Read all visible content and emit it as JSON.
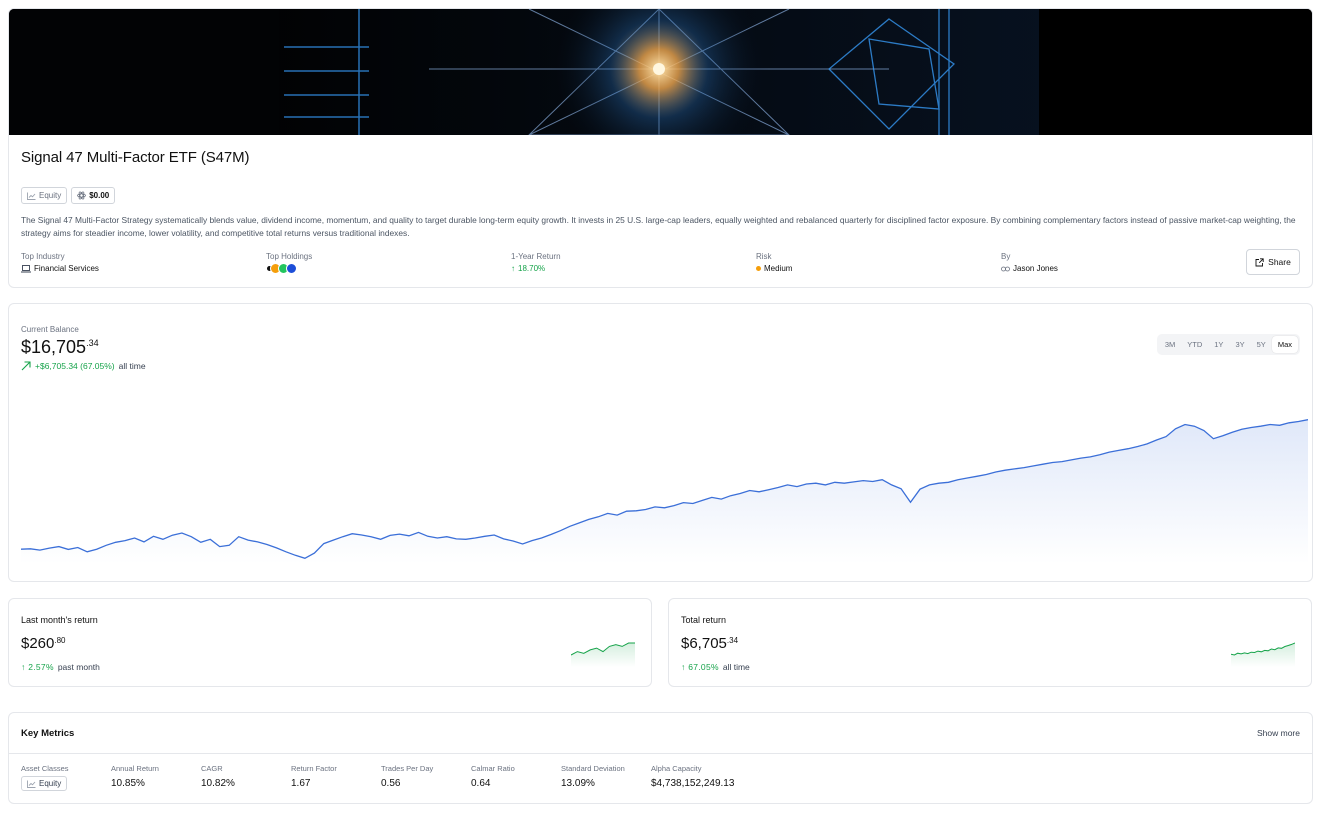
{
  "strategy": {
    "title": "Signal 47 Multi-Factor ETF (S47M)",
    "badges": {
      "asset_class": "Equity",
      "price": "$0.00"
    },
    "description": "The Signal 47 Multi-Factor Strategy systematically blends value, dividend income, momentum, and quality to target durable long-term equity growth. It invests in 25 U.S. large-cap leaders, equally weighted and rebalanced quarterly for disciplined factor exposure. By combining complementary factors instead of passive market-cap weighting, the strategy aims for steadier income, lower volatility, and competitive total returns versus traditional indexes.",
    "stats": {
      "top_industry_label": "Top Industry",
      "top_industry_value": "Financial Services",
      "top_holdings_label": "Top Holdings",
      "one_year_label": "1-Year Return",
      "one_year_value": "18.70%",
      "risk_label": "Risk",
      "risk_value": "Medium",
      "by_label": "By",
      "by_value": "Jason Jones"
    },
    "share_label": "Share",
    "holding_colors": [
      "#111111",
      "#f59e0b",
      "#22c55e",
      "#1d4ed8"
    ]
  },
  "balance": {
    "label": "Current Balance",
    "value_main": "$16,705",
    "value_cents": ".34",
    "change": "+$6,705.34 (67.05%)",
    "change_suffix": "all time",
    "ranges": [
      "3M",
      "YTD",
      "1Y",
      "3Y",
      "5Y",
      "Max"
    ],
    "active_range": "Max"
  },
  "last_month": {
    "label": "Last month's return",
    "value_main": "$260",
    "value_cents": ".80",
    "change": "2.57%",
    "change_suffix": "past month"
  },
  "total_return": {
    "label": "Total return",
    "value_main": "$6,705",
    "value_cents": ".34",
    "change": "67.05%",
    "change_suffix": "all time"
  },
  "metrics": {
    "title": "Key Metrics",
    "show_more": "Show more",
    "items": [
      {
        "label": "Asset Classes",
        "value": "Equity"
      },
      {
        "label": "Annual Return",
        "value": "10.85%"
      },
      {
        "label": "CAGR",
        "value": "10.82%"
      },
      {
        "label": "Return Factor",
        "value": "1.67"
      },
      {
        "label": "Trades Per Day",
        "value": "0.56"
      },
      {
        "label": "Calmar Ratio",
        "value": "0.64"
      },
      {
        "label": "Standard Deviation",
        "value": "13.09%"
      },
      {
        "label": "Alpha Capacity",
        "value": "$4,738,152,249.13"
      }
    ]
  },
  "colors": {
    "accent": "#3b6fd8",
    "positive": "#16a34a",
    "risk": "#f59e0b"
  },
  "chart_data": {
    "type": "area",
    "ylim": [
      9800,
      17400
    ],
    "values": [
      10300,
      10320,
      10260,
      10350,
      10420,
      10290,
      10380,
      10180,
      10300,
      10480,
      10620,
      10700,
      10820,
      10640,
      10900,
      10760,
      10950,
      11050,
      10880,
      10620,
      10760,
      10420,
      10480,
      10880,
      10720,
      10640,
      10520,
      10360,
      10180,
      10020,
      9880,
      10120,
      10560,
      10720,
      10880,
      11020,
      10960,
      10880,
      10760,
      10940,
      11000,
      10920,
      11080,
      10900,
      10820,
      10880,
      10780,
      10760,
      10820,
      10900,
      10960,
      10780,
      10680,
      10540,
      10700,
      10820,
      10980,
      11160,
      11360,
      11520,
      11680,
      11800,
      11960,
      11880,
      12060,
      12080,
      12140,
      12260,
      12220,
      12320,
      12460,
      12420,
      12560,
      12700,
      12620,
      12780,
      12880,
      13020,
      12960,
      13060,
      13160,
      13280,
      13200,
      13320,
      13360,
      13280,
      13400,
      13360,
      13420,
      13480,
      13440,
      13520,
      13280,
      13100,
      12480,
      13080,
      13280,
      13360,
      13400,
      13520,
      13600,
      13680,
      13760,
      13880,
      13960,
      14020,
      14080,
      14160,
      14240,
      14320,
      14360,
      14440,
      14520,
      14580,
      14680,
      14800,
      14880,
      14960,
      15060,
      15180,
      15360,
      15520,
      15880,
      16080,
      16000,
      15800,
      15420,
      15560,
      15720,
      15860,
      15940,
      16000,
      16080,
      16040,
      16160,
      16220,
      16300
    ]
  },
  "last_month_spark": {
    "values": [
      260.1,
      260.3,
      260.2,
      260.4,
      260.5,
      260.3,
      260.6,
      260.7,
      260.6,
      260.8,
      260.8
    ]
  },
  "total_spark": {
    "values": [
      30,
      28,
      33,
      31,
      34,
      32,
      36,
      35,
      39,
      37,
      41,
      40,
      45,
      43,
      48,
      47,
      52,
      55,
      58,
      62
    ]
  }
}
